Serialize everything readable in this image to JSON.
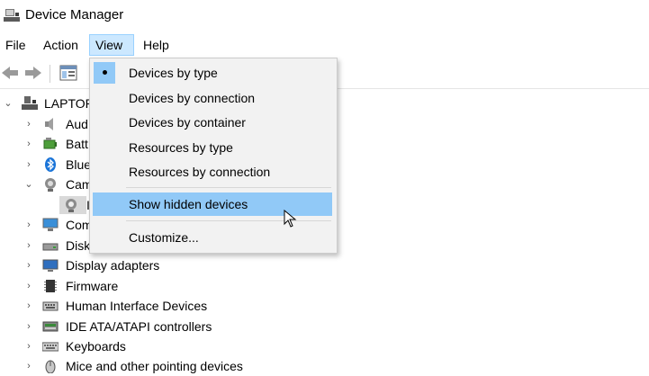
{
  "window": {
    "title": "Device Manager"
  },
  "menubar": {
    "file": "File",
    "action": "Action",
    "view": "View",
    "help": "Help"
  },
  "view_menu": {
    "items": [
      {
        "label": "Devices by type",
        "checked": true
      },
      {
        "label": "Devices by connection"
      },
      {
        "label": "Devices by container"
      },
      {
        "label": "Resources by type"
      },
      {
        "label": "Resources by connection"
      },
      {
        "label": "Show hidden devices",
        "highlighted": true
      },
      {
        "label": "Customize..."
      }
    ]
  },
  "tree": {
    "root": "LAPTOP-",
    "items": [
      {
        "label": "Aud",
        "icon": "speaker-icon",
        "state": "collapsed"
      },
      {
        "label": "Batt",
        "icon": "battery-icon",
        "state": "collapsed"
      },
      {
        "label": "Blue",
        "icon": "bluetooth-icon",
        "state": "collapsed"
      },
      {
        "label": "Cam",
        "icon": "camera-icon",
        "state": "expanded"
      },
      {
        "label": "I",
        "icon": "webcam-icon",
        "state": "child"
      },
      {
        "label": "Com",
        "icon": "monitor-icon",
        "state": "collapsed"
      },
      {
        "label": "Disk",
        "icon": "disk-icon",
        "state": "collapsed"
      },
      {
        "label": "Display adapters",
        "icon": "display-adapter-icon",
        "state": "collapsed"
      },
      {
        "label": "Firmware",
        "icon": "chip-icon",
        "state": "collapsed"
      },
      {
        "label": "Human Interface Devices",
        "icon": "hid-icon",
        "state": "collapsed"
      },
      {
        "label": "IDE ATA/ATAPI controllers",
        "icon": "ide-icon",
        "state": "collapsed"
      },
      {
        "label": "Keyboards",
        "icon": "keyboard-icon",
        "state": "collapsed"
      },
      {
        "label": "Mice and other pointing devices",
        "icon": "mouse-icon",
        "state": "collapsed"
      }
    ]
  }
}
